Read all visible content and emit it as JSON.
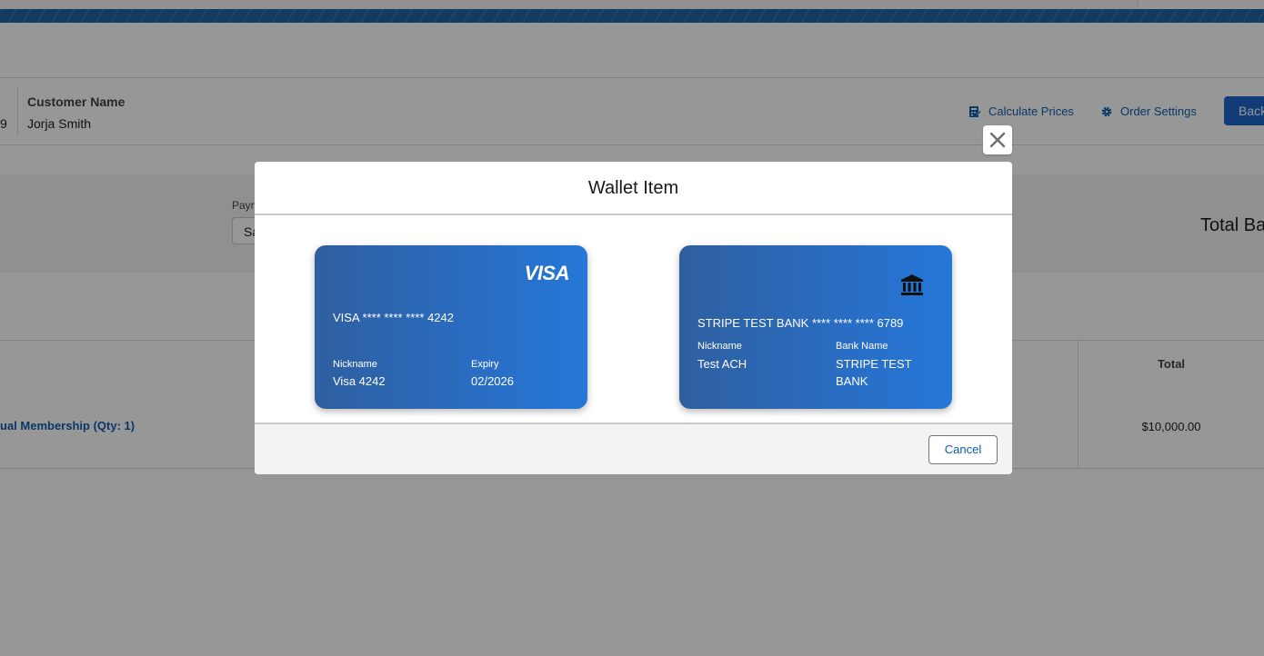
{
  "background": {
    "record": {
      "number_suffix": "9",
      "customer_label": "Customer Name",
      "customer_value": "Jorja Smith"
    },
    "actions": {
      "calculate_prices": "Calculate Prices",
      "order_settings": "Order Settings",
      "back": "Back"
    },
    "payment": {
      "label": "Paym",
      "select_value": "Sa"
    },
    "total_balance_label": "Total Ba",
    "table": {
      "total_header": "Total",
      "rows": [
        {
          "item": "ual Membership (Qty: 1)",
          "total": "$10,000.00"
        }
      ]
    }
  },
  "modal": {
    "title": "Wallet Item",
    "cancel_label": "Cancel",
    "close_icon": "close-icon",
    "cards": [
      {
        "type": "card",
        "brand": "VISA",
        "number": "VISA **** **** **** 4242",
        "nickname_label": "Nickname",
        "nickname": "Visa 4242",
        "expiry_label": "Expiry",
        "expiry": "02/2026"
      },
      {
        "type": "bank",
        "icon": "bank-icon",
        "number": "STRIPE TEST BANK **** **** **** 6789",
        "nickname_label": "Nickname",
        "nickname": "Test ACH",
        "bank_name_label": "Bank Name",
        "bank_name": "STRIPE TEST BANK"
      }
    ]
  },
  "colors": {
    "brand_blue": "#1b5fa5",
    "link_blue": "#0b5cab",
    "card_gradient_start": "#2e5f9f",
    "card_gradient_end": "#2577d9"
  }
}
